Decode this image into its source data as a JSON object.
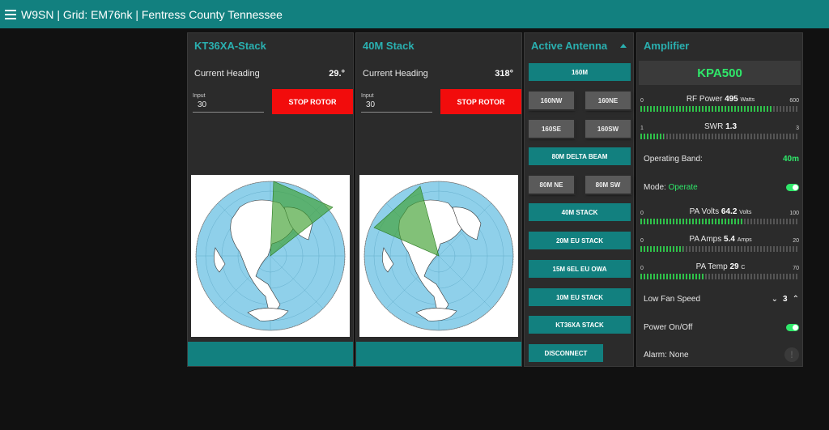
{
  "header": {
    "title": "W9SN | Grid: EM76nk | Fentress County Tennessee"
  },
  "rotors": [
    {
      "title": "KT36XA-Stack",
      "heading_label": "Current Heading",
      "heading_value": "29.°",
      "input_label": "Input",
      "input_value": "30",
      "stop_label": "STOP ROTOR"
    },
    {
      "title": "40M Stack",
      "heading_label": "Current Heading",
      "heading_value": "318°",
      "input_label": "Input",
      "input_value": "30",
      "stop_label": "STOP ROTOR"
    }
  ],
  "antenna": {
    "title": "Active Antenna",
    "buttons": [
      "160M",
      "160NW",
      "160NE",
      "160SE",
      "160SW",
      "80M DELTA BEAM",
      "80M NE",
      "80M SW",
      "40M STACK",
      "20M EU STACK",
      "15M 6EL EU OWA",
      "10M EU STACK",
      "KT36XA STACK",
      "DISCONNECT"
    ]
  },
  "amplifier": {
    "title": "Amplifier",
    "model": "KPA500",
    "rf_power": {
      "label": "RF Power",
      "value": "495",
      "unit": "Watts",
      "min": "0",
      "max": "600",
      "level": 0.825
    },
    "swr": {
      "label": "SWR",
      "value": "1.3",
      "unit": "",
      "min": "1",
      "max": "3",
      "level": 0.15
    },
    "operating_band_label": "Operating Band:",
    "operating_band_value": "40m",
    "mode_label": "Mode:",
    "mode_value": "Operate",
    "pa_volts": {
      "label": "PA Volts",
      "value": "64.2",
      "unit": "Volts",
      "min": "0",
      "max": "100",
      "level": 0.642
    },
    "pa_amps": {
      "label": "PA Amps",
      "value": "5.4",
      "unit": "Amps",
      "min": "0",
      "max": "20",
      "level": 0.27
    },
    "pa_temp": {
      "label": "PA Temp",
      "value": "29",
      "unit": "C",
      "min": "0",
      "max": "70",
      "level": 0.41
    },
    "fan_label": "Low Fan Speed",
    "fan_value": "3",
    "power_label": "Power On/Off",
    "alarm_label": "Alarm: None",
    "alarm_icon": "!"
  },
  "colors": {
    "teal": "#12807f",
    "accent_text": "#2ab0b0",
    "stop_red": "#f20c0c",
    "green": "#2fe86a"
  }
}
